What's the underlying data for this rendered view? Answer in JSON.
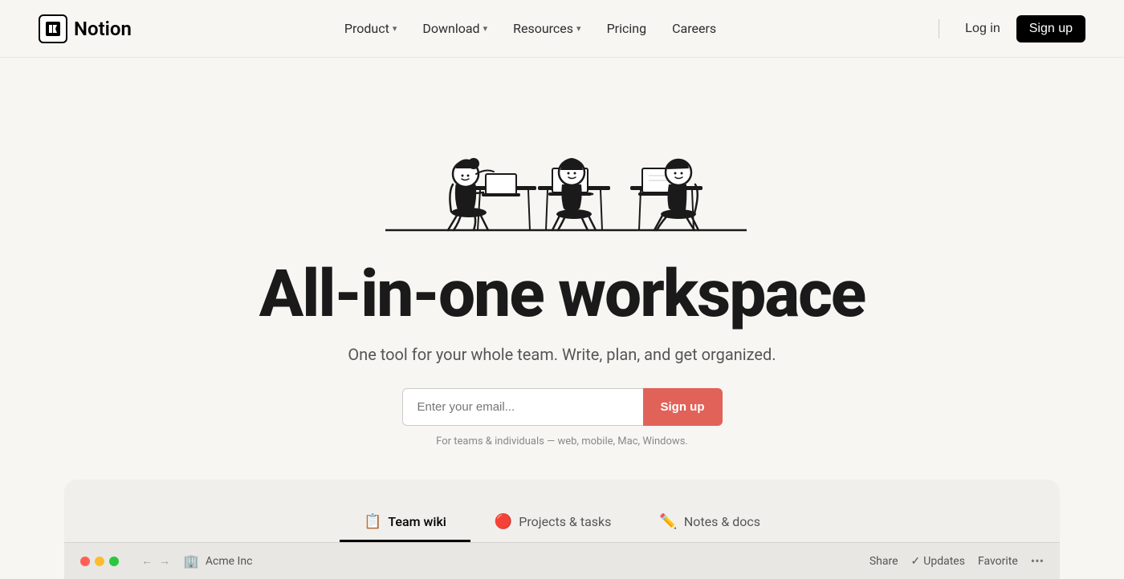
{
  "navbar": {
    "logo_icon": "N",
    "logo_text": "Notion",
    "nav_items": [
      {
        "label": "Product",
        "has_dropdown": true
      },
      {
        "label": "Download",
        "has_dropdown": true
      },
      {
        "label": "Resources",
        "has_dropdown": true
      },
      {
        "label": "Pricing",
        "has_dropdown": false
      },
      {
        "label": "Careers",
        "has_dropdown": false
      }
    ],
    "login_label": "Log in",
    "signup_label": "Sign up"
  },
  "hero": {
    "title": "All-in-one workspace",
    "subtitle": "One tool for your whole team. Write, plan, and get organized.",
    "email_placeholder": "Enter your email...",
    "signup_button": "Sign up",
    "note": "For teams & individuals — web, mobile, Mac, Windows."
  },
  "tabs": [
    {
      "label": "Team wiki",
      "emoji": "📋",
      "active": true
    },
    {
      "label": "Projects & tasks",
      "emoji": "🔴",
      "active": false
    },
    {
      "label": "Notes & docs",
      "emoji": "✏️",
      "active": false
    }
  ],
  "app_bar": {
    "breadcrumb_icon": "🏢",
    "breadcrumb_text": "Acme Inc",
    "share_label": "Share",
    "updates_label": "Updates",
    "updates_icon": "✓",
    "favorite_label": "Favorite",
    "more_icon": "•••"
  }
}
